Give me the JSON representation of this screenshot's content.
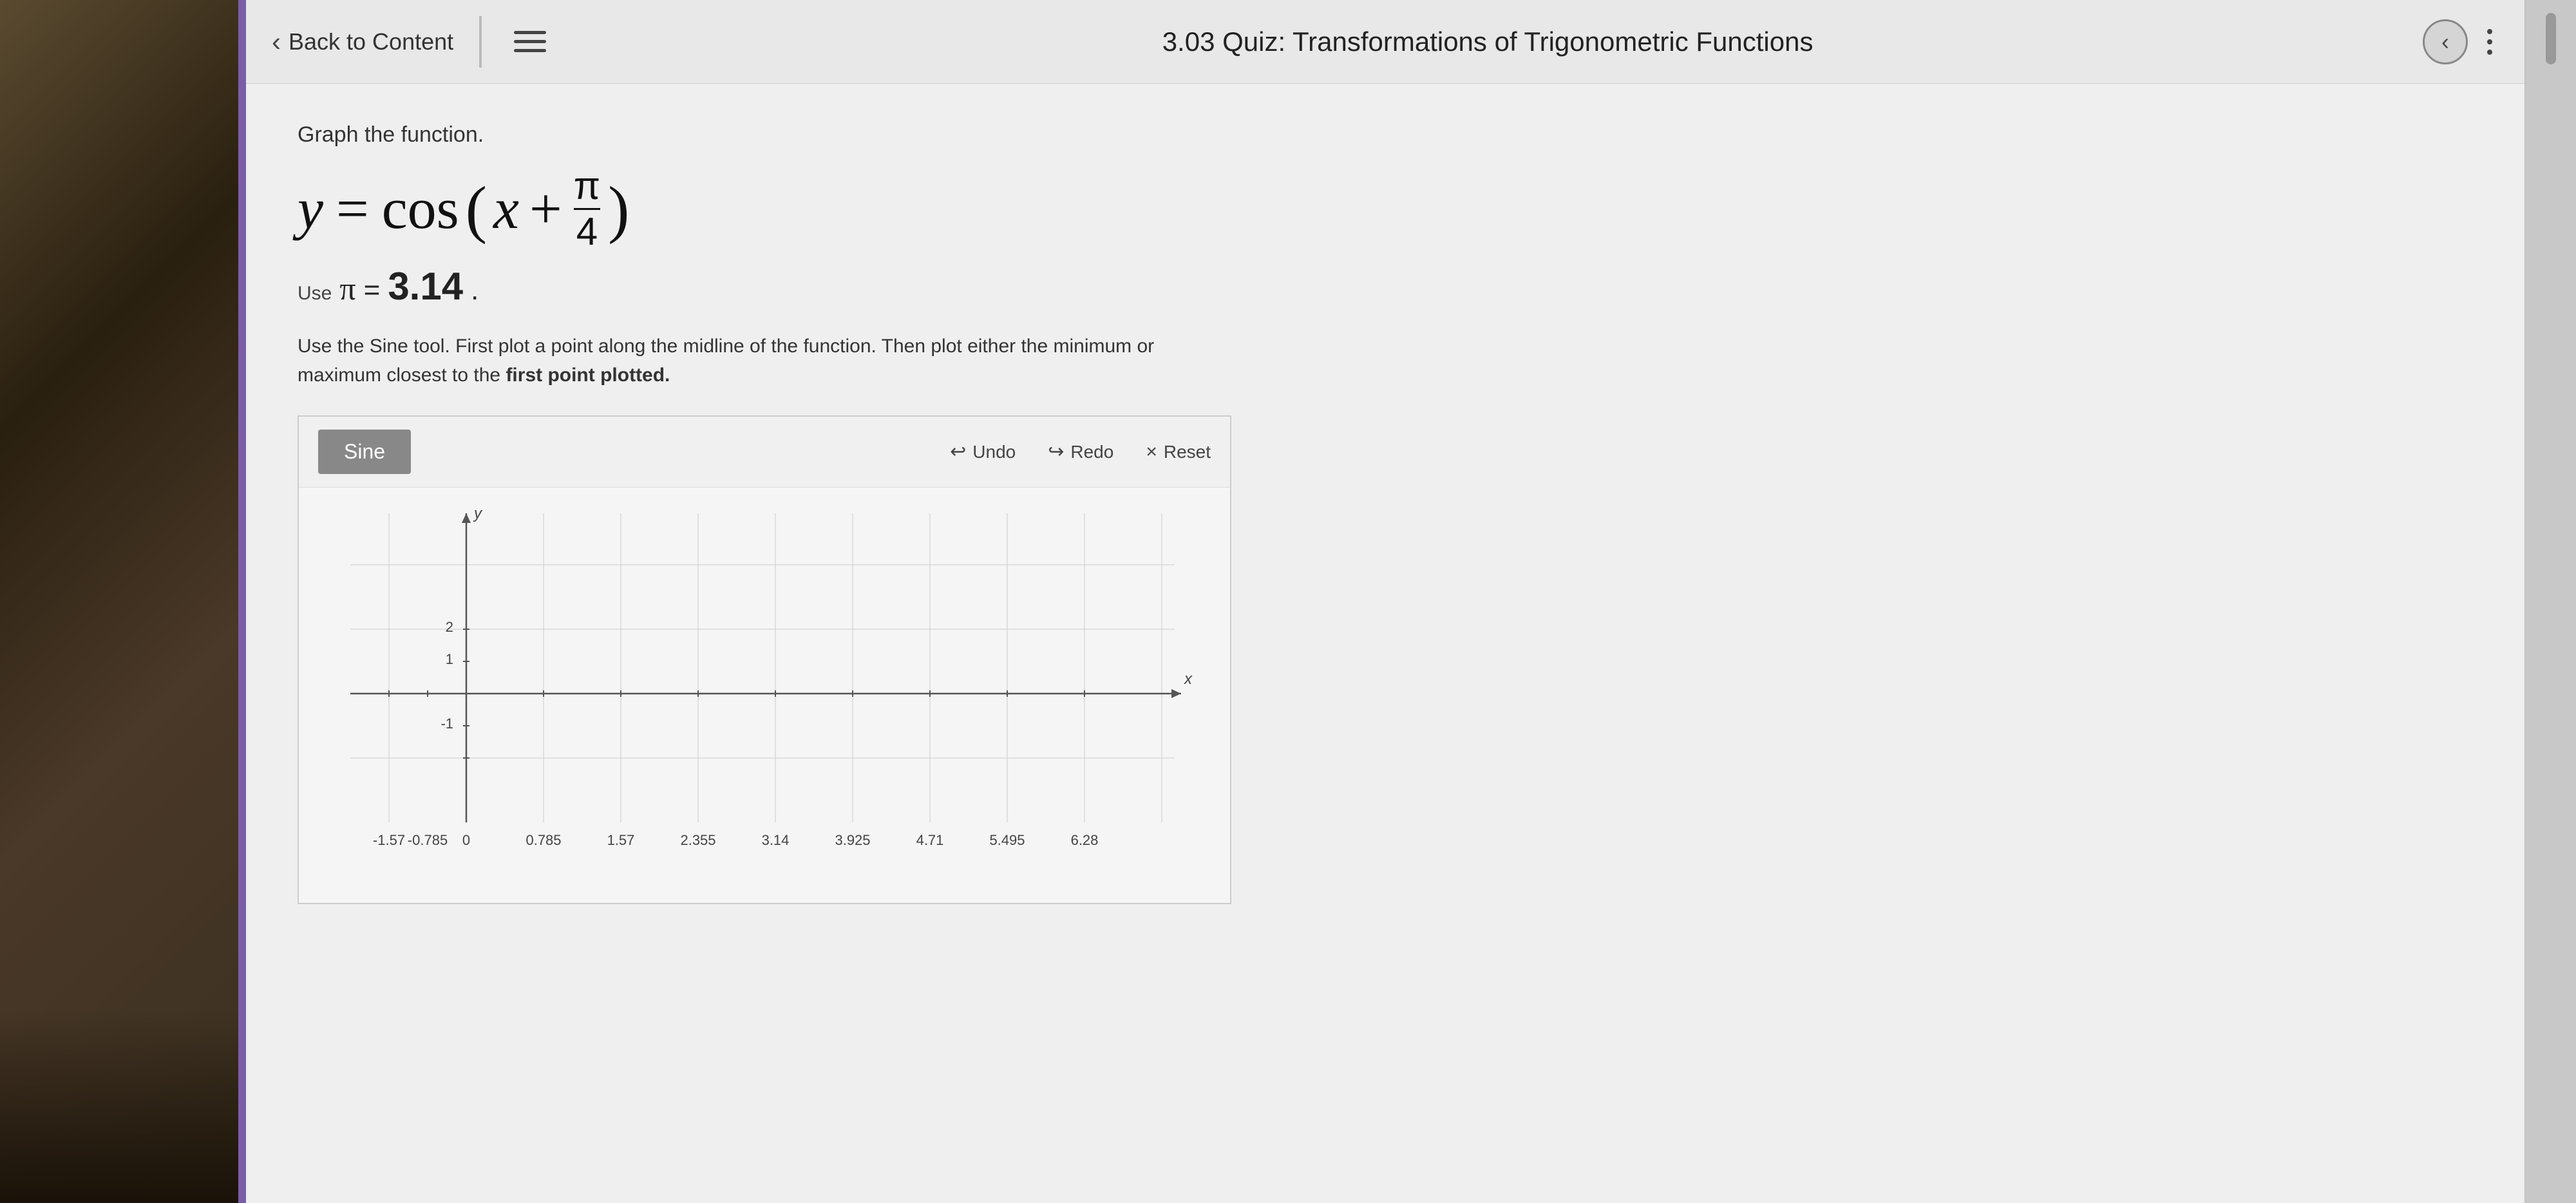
{
  "header": {
    "back_label": "Back to Content",
    "title": "3.03 Quiz: Transformations of Trigonometric Functions"
  },
  "toolbar": {
    "sine_button": "Sine",
    "undo_label": "Undo",
    "redo_label": "Redo",
    "reset_label": "Reset"
  },
  "question": {
    "instruction": "Graph the function.",
    "function_label": "y = cos (x + π/4)",
    "pi_line": "Use π = 3.14.",
    "directions": "Use the Sine tool. First plot a point along the midline of the function. Then plot either the minimum or maximum closest to the first point plotted."
  },
  "graph": {
    "x_labels": [
      "-1.57",
      "-0.785",
      "0",
      "0.785",
      "1.57",
      "2.355",
      "3.14",
      "3.925",
      "4.71",
      "5.495",
      "6.28"
    ],
    "y_labels": [
      "-1",
      "1",
      "2"
    ],
    "x_axis_label": "x",
    "y_axis_label": "y"
  },
  "icons": {
    "back_arrow": "‹",
    "hamburger": "≡",
    "nav_left": "‹",
    "undo_arrow": "↩",
    "redo_arrow": "↪",
    "close": "×"
  }
}
